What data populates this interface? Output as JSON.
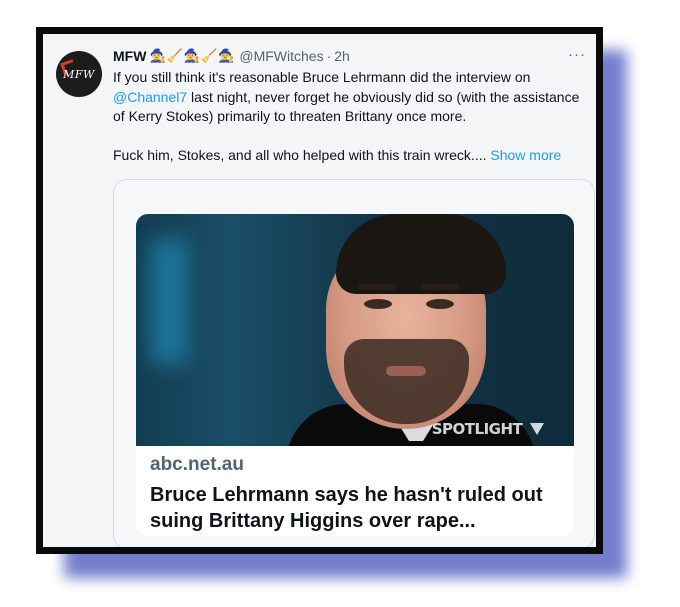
{
  "tweet": {
    "avatar_text": "MFW",
    "name": "MFW",
    "emoji": [
      "🧙‍♀️",
      "🧹",
      "🧙‍♀️",
      "🧹",
      "🧙‍♀️"
    ],
    "handle": "@MFWitches",
    "separator": "·",
    "time": "2h",
    "more_label": "···",
    "text_line1_pre": "If you still think it's reasonable Bruce Lehrmann did the interview on ",
    "mention": "@Channel7",
    "text_line1_post": " last night, never forget he obviously did so (with the assistance of Kerry Stokes) primarily to threaten Brittany once more.",
    "text_para2": "Fuck him, Stokes, and all who helped with this train wreck.... ",
    "show_more": "Show more"
  },
  "card": {
    "watermark": "SPOTLIGHT",
    "domain": "abc.net.au",
    "title": "Bruce Lehrmann says he hasn't ruled out suing Brittany Higgins over rape..."
  },
  "colors": {
    "link": "#1d9bf0",
    "frame": "#0a0a0a",
    "shadow": "#5a67c4"
  }
}
